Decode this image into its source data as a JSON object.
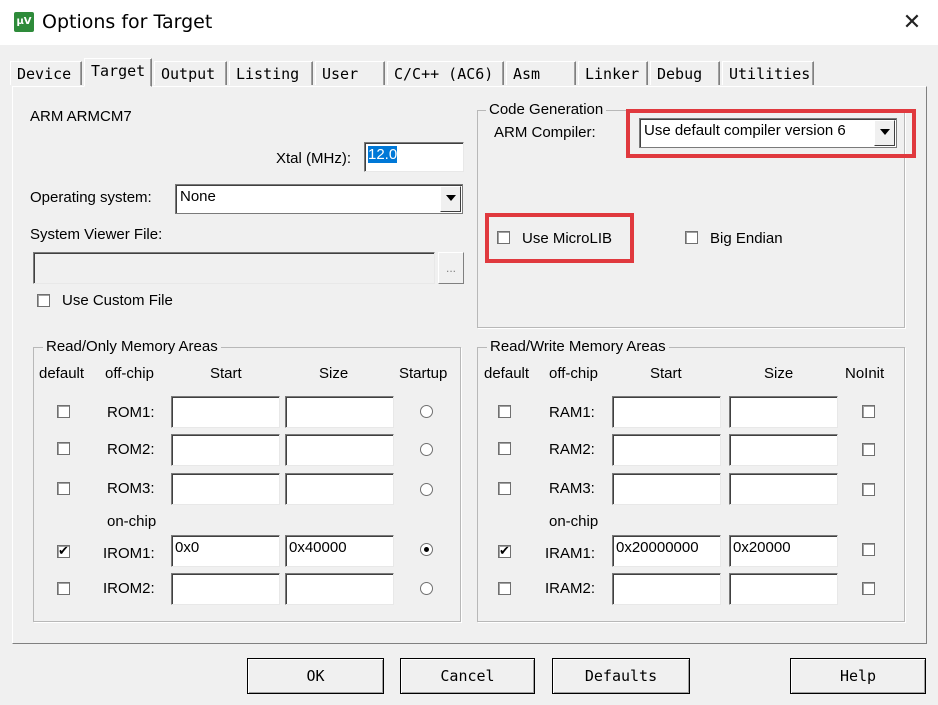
{
  "window": {
    "title": "Options for Target",
    "icon": "uvision-icon",
    "close_glyph": "✕"
  },
  "tabs": [
    "Device",
    "Target",
    "Output",
    "Listing",
    "User",
    "C/C++ (AC6)",
    "Asm",
    "Linker",
    "Debug",
    "Utilities"
  ],
  "active_tab": "Target",
  "target": {
    "device_name": "ARM ARMCM7",
    "xtal_label": "Xtal (MHz):",
    "xtal_value": "12.0",
    "os_label": "Operating system:",
    "os_value": "None",
    "sv_label": "System Viewer File:",
    "sv_value": "",
    "browse": "...",
    "custom_file_label": "Use Custom File"
  },
  "codegen": {
    "title": "Code Generation",
    "compiler_label": "ARM Compiler:",
    "compiler_value": "Use default compiler version 6",
    "microlib_label": "Use MicroLIB",
    "bigendian_label": "Big Endian"
  },
  "rom": {
    "title": "Read/Only Memory Areas",
    "headers": {
      "default": "default",
      "offchip": "off-chip",
      "start": "Start",
      "size": "Size",
      "last": "Startup"
    },
    "onchip_label": "on-chip",
    "rows": [
      {
        "name": "ROM1:",
        "start": "",
        "size": "",
        "default": false,
        "startup": false
      },
      {
        "name": "ROM2:",
        "start": "",
        "size": "",
        "default": false,
        "startup": false
      },
      {
        "name": "ROM3:",
        "start": "",
        "size": "",
        "default": false,
        "startup": false
      },
      {
        "name": "IROM1:",
        "start": "0x0",
        "size": "0x40000",
        "default": true,
        "startup": true
      },
      {
        "name": "IROM2:",
        "start": "",
        "size": "",
        "default": false,
        "startup": false
      }
    ]
  },
  "ram": {
    "title": "Read/Write Memory Areas",
    "headers": {
      "default": "default",
      "offchip": "off-chip",
      "start": "Start",
      "size": "Size",
      "last": "NoInit"
    },
    "onchip_label": "on-chip",
    "rows": [
      {
        "name": "RAM1:",
        "start": "",
        "size": "",
        "default": false,
        "noinit": false
      },
      {
        "name": "RAM2:",
        "start": "",
        "size": "",
        "default": false,
        "noinit": false
      },
      {
        "name": "RAM3:",
        "start": "",
        "size": "",
        "default": false,
        "noinit": false
      },
      {
        "name": "IRAM1:",
        "start": "0x20000000",
        "size": "0x20000",
        "default": true,
        "noinit": false
      },
      {
        "name": "IRAM2:",
        "start": "",
        "size": "",
        "default": false,
        "noinit": false
      }
    ]
  },
  "buttons": {
    "ok": "OK",
    "cancel": "Cancel",
    "defaults": "Defaults",
    "help": "Help"
  },
  "colors": {
    "highlight": "#e0393e",
    "selection": "#0078d7"
  }
}
